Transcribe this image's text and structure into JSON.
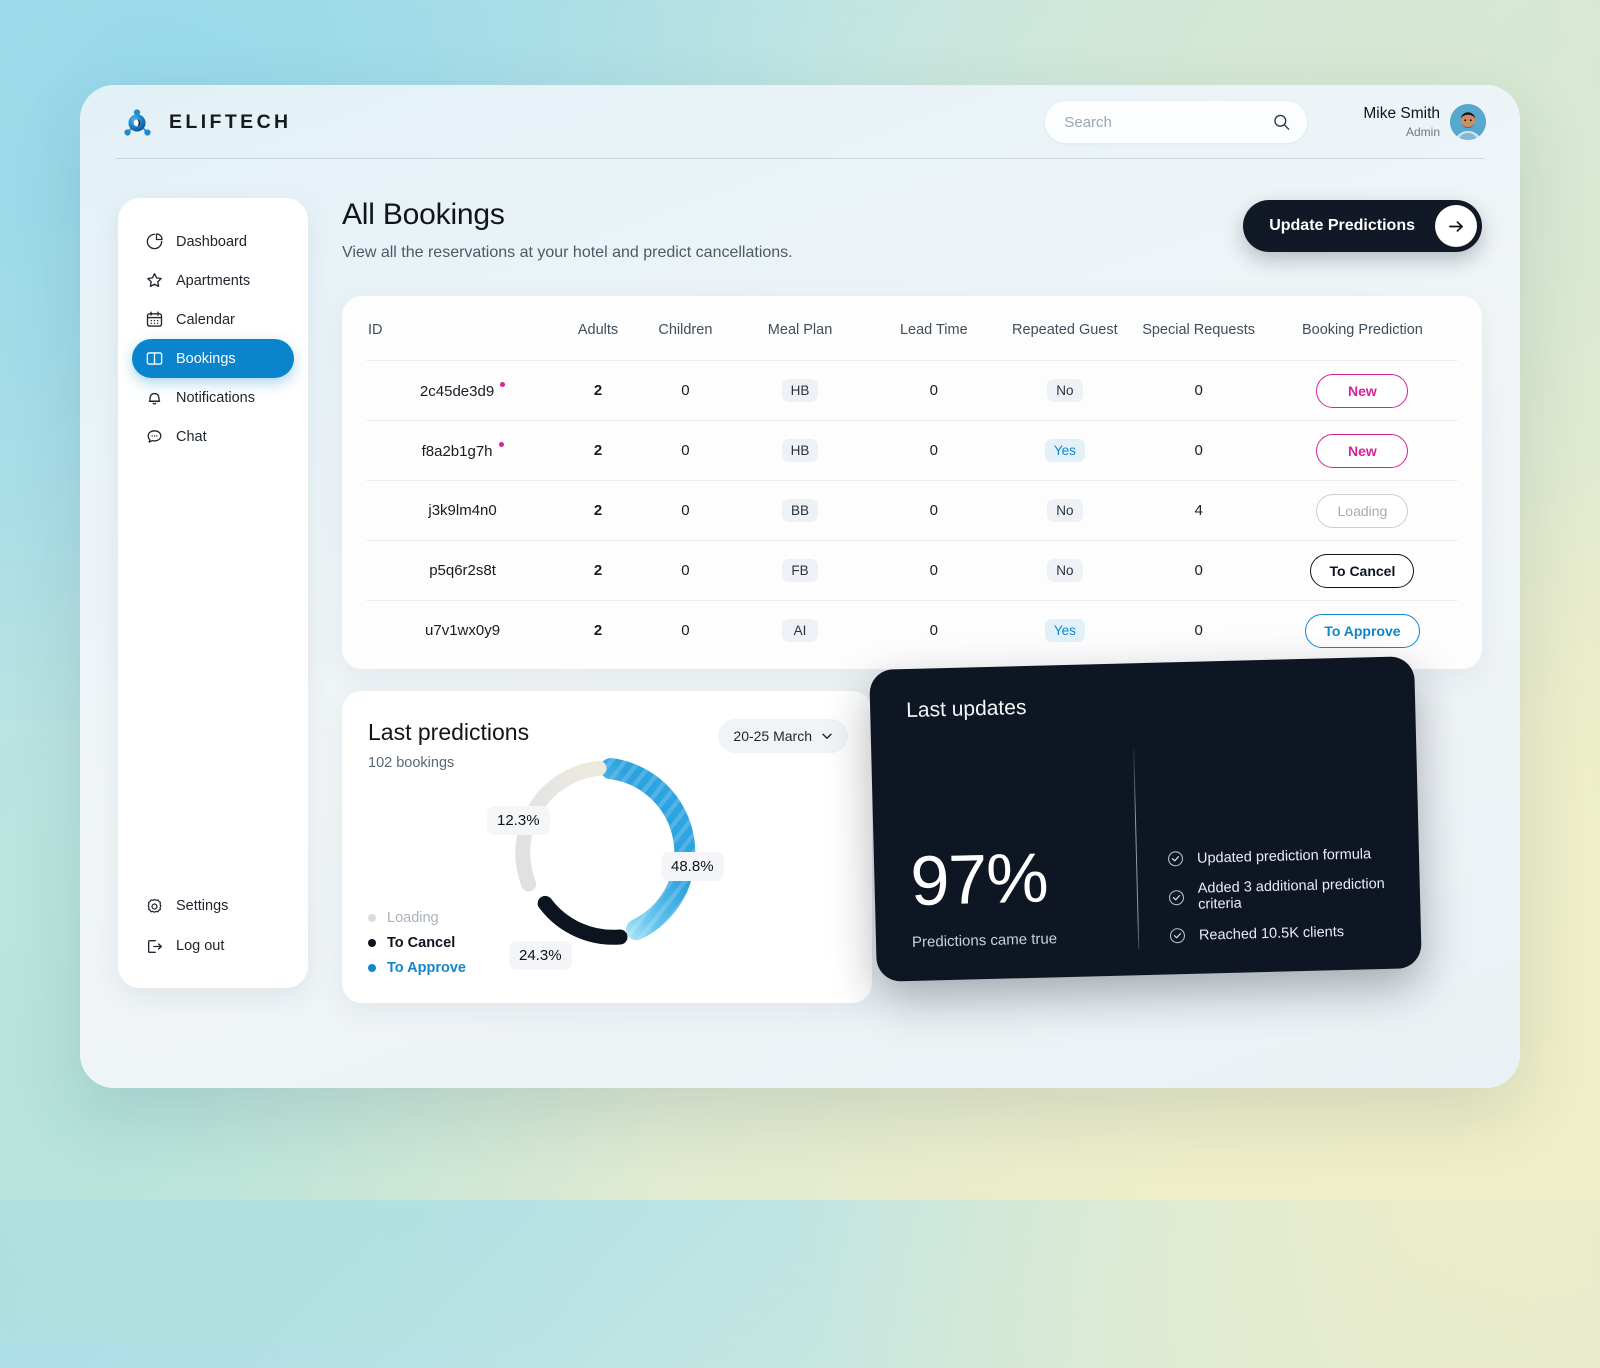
{
  "brand": {
    "name": "ELIFTECH",
    "logo_icon": "eliftech-atom-logo"
  },
  "topbar": {
    "search": {
      "placeholder": "Search",
      "value": "",
      "icon": "search-icon"
    },
    "user": {
      "name": "Mike Smith",
      "role": "Admin",
      "avatar_icon": "user-avatar"
    }
  },
  "sidebar": {
    "items": [
      {
        "label": "Dashboard",
        "icon": "pie-chart-icon",
        "active": false
      },
      {
        "label": "Apartments",
        "icon": "star-icon",
        "active": false
      },
      {
        "label": "Calendar",
        "icon": "calendar-icon",
        "active": false
      },
      {
        "label": "Bookings",
        "icon": "book-icon",
        "active": true
      },
      {
        "label": "Notifications",
        "icon": "bell-icon",
        "active": false
      },
      {
        "label": "Chat",
        "icon": "chat-bubble-icon",
        "active": false
      }
    ],
    "bottom_items": [
      {
        "label": "Settings",
        "icon": "gear-icon"
      },
      {
        "label": "Log out",
        "icon": "logout-icon"
      }
    ]
  },
  "page": {
    "title": "All Bookings",
    "subtitle": "View all the reservations at your hotel and predict cancellations.",
    "update_button": {
      "label": "Update Predictions",
      "icon": "arrow-right-icon"
    }
  },
  "table": {
    "columns": [
      "ID",
      "Adults",
      "Children",
      "Meal Plan",
      "Lead Time",
      "Repeated Guest",
      "Special Requests",
      "Booking Prediction"
    ],
    "rows": [
      {
        "id": "2c45de3d9",
        "flagged": true,
        "adults": "2",
        "children": "0",
        "meal_plan": "HB",
        "lead_time": "0",
        "repeated_guest": "No",
        "special_requests": "0",
        "prediction": "New",
        "prediction_style": "new"
      },
      {
        "id": "f8a2b1g7h",
        "flagged": true,
        "adults": "2",
        "children": "0",
        "meal_plan": "HB",
        "lead_time": "0",
        "repeated_guest": "Yes",
        "special_requests": "0",
        "prediction": "New",
        "prediction_style": "new"
      },
      {
        "id": "j3k9lm4n0",
        "flagged": false,
        "adults": "2",
        "children": "0",
        "meal_plan": "BB",
        "lead_time": "0",
        "repeated_guest": "No",
        "special_requests": "4",
        "prediction": "Loading",
        "prediction_style": "loading"
      },
      {
        "id": "p5q6r2s8t",
        "flagged": false,
        "adults": "2",
        "children": "0",
        "meal_plan": "FB",
        "lead_time": "0",
        "repeated_guest": "No",
        "special_requests": "0",
        "prediction": "To Cancel",
        "prediction_style": "cancel"
      },
      {
        "id": "u7v1wx0y9",
        "flagged": false,
        "adults": "2",
        "children": "0",
        "meal_plan": "AI",
        "lead_time": "0",
        "repeated_guest": "Yes",
        "special_requests": "0",
        "prediction": "To Approve",
        "prediction_style": "approve"
      }
    ]
  },
  "predictions_card": {
    "title": "Last predictions",
    "subtitle": "102 bookings",
    "date_range": "20-25 March",
    "date_icon": "chevron-down-icon",
    "legend": [
      {
        "label": "Loading",
        "color": "#d9dde1"
      },
      {
        "label": "To Cancel",
        "color": "#0d1420"
      },
      {
        "label": "To Approve",
        "color": "#1186cd"
      }
    ]
  },
  "chart_data": {
    "type": "pie",
    "title": "Last predictions",
    "subtitle": "102 bookings",
    "categories": [
      "To Approve",
      "To Cancel",
      "Loading"
    ],
    "values": [
      48.8,
      24.3,
      12.3
    ],
    "labels": [
      "48.8%",
      "24.3%",
      "12.3%"
    ],
    "colors": [
      "#2aa3e0",
      "#0d1420",
      "#dfe2e4"
    ],
    "legend_position": "bottom-left",
    "grid": false,
    "donut": true,
    "total_label": "102 bookings"
  },
  "updates_card": {
    "title": "Last updates",
    "big_value": "97%",
    "caption": "Predictions came true",
    "items": [
      {
        "label": "Updated prediction formula",
        "icon": "check-circle-icon"
      },
      {
        "label": "Added 3 additional prediction criteria",
        "icon": "check-circle-icon"
      },
      {
        "label": "Reached 10.5K clients",
        "icon": "check-circle-icon"
      }
    ]
  },
  "colors": {
    "accent_blue": "#0b84ce",
    "accent_pink": "#d6219b",
    "dark": "#0f1623",
    "card_bg": "#ffffff"
  }
}
